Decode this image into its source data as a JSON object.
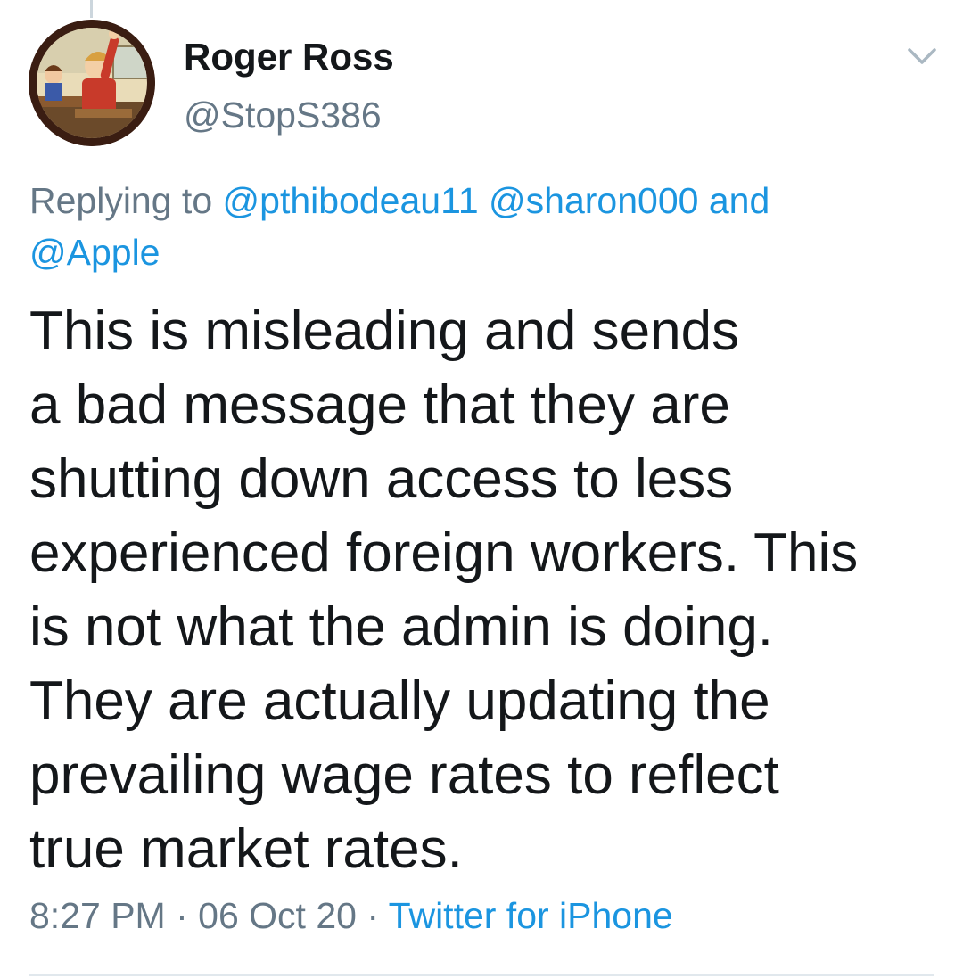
{
  "author": {
    "display_name": "Roger Ross",
    "handle": "@StopS386"
  },
  "reply_context": {
    "prefix": "Replying to",
    "mentions": [
      "@pthibodeau11",
      "@sharon000",
      "@Apple"
    ],
    "conjunction": "and"
  },
  "tweet": {
    "lines": [
      "This is misleading and sends",
      "a bad message that they are",
      "shutting down access to less",
      "experienced foreign workers. This",
      "is not what the admin is doing.",
      "They are actually updating the",
      "prevailing wage rates to reflect",
      "true market rates."
    ]
  },
  "meta": {
    "time": "8:27 PM",
    "date": "06 Oct 20",
    "separator": "·",
    "source": "Twitter for iPhone"
  },
  "icons": {
    "caret": "chevron-down-icon",
    "avatar": "avatar"
  },
  "colors": {
    "link": "#1b95e0",
    "secondary_text": "#657786",
    "primary_text": "#14171a"
  }
}
